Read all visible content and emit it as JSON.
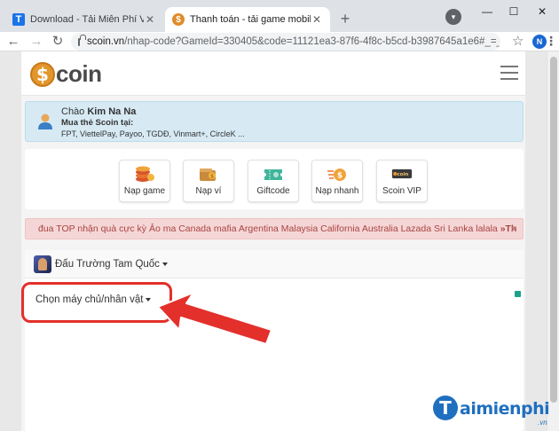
{
  "browser": {
    "tabs": [
      {
        "title": "Download - Tải Miễn Phí VN - Ph",
        "icon": "taimienphi-favicon",
        "active": false
      },
      {
        "title": "Thanh toán - tải game mobile c",
        "icon": "scoin-favicon",
        "active": true
      }
    ],
    "new_tab_label": "+",
    "window_controls": {
      "minimize": "—",
      "maximize": "☐",
      "close": "✕"
    },
    "url": {
      "host": "scoin.vn",
      "rest": "/nhap-code?GameId=330405&code=11121ea3-87f6-4f8c-b5cd-b3987645a1e6#_=_"
    },
    "profile_initial": "N"
  },
  "site": {
    "logo_text": "coin",
    "logo_mark": "$",
    "greeting": {
      "hello": "Chào",
      "user_name": "Kim Na Na",
      "buy_label": "Mua thẻ Scoin tại:",
      "vendors": "FPT, ViettelPay, Payoo, TGDĐ, Vinmart+, CircleK ..."
    },
    "actions": [
      {
        "label": "Nạp game",
        "icon": "coins-stack-icon"
      },
      {
        "label": "Nạp ví",
        "icon": "wallet-coin-icon"
      },
      {
        "label": "Giftcode",
        "icon": "ticket-icon"
      },
      {
        "label": "Nạp nhanh",
        "icon": "fast-coin-icon"
      },
      {
        "label": "Scoin VIP",
        "icon": "vip-card-icon"
      }
    ],
    "notice": {
      "text": "đua TOP nhận quà cực kỳ Ảo ma Canada mafia Argentina Malaysia California Australia Lazada Sri Lanka lalala",
      "tail": "»Th",
      "close": "×"
    },
    "game": {
      "name": "Đấu Trường Tam Quốc",
      "server_select": "Chọn máy chủ/nhân vật"
    }
  },
  "watermark": {
    "mark": "T",
    "text": "aimienphi",
    "suffix": ".vn"
  },
  "colors": {
    "accent_red": "#e3302b",
    "brand_orange": "#e3962c",
    "notice_text": "#a94442",
    "watermark_blue": "#1f6fc0"
  }
}
